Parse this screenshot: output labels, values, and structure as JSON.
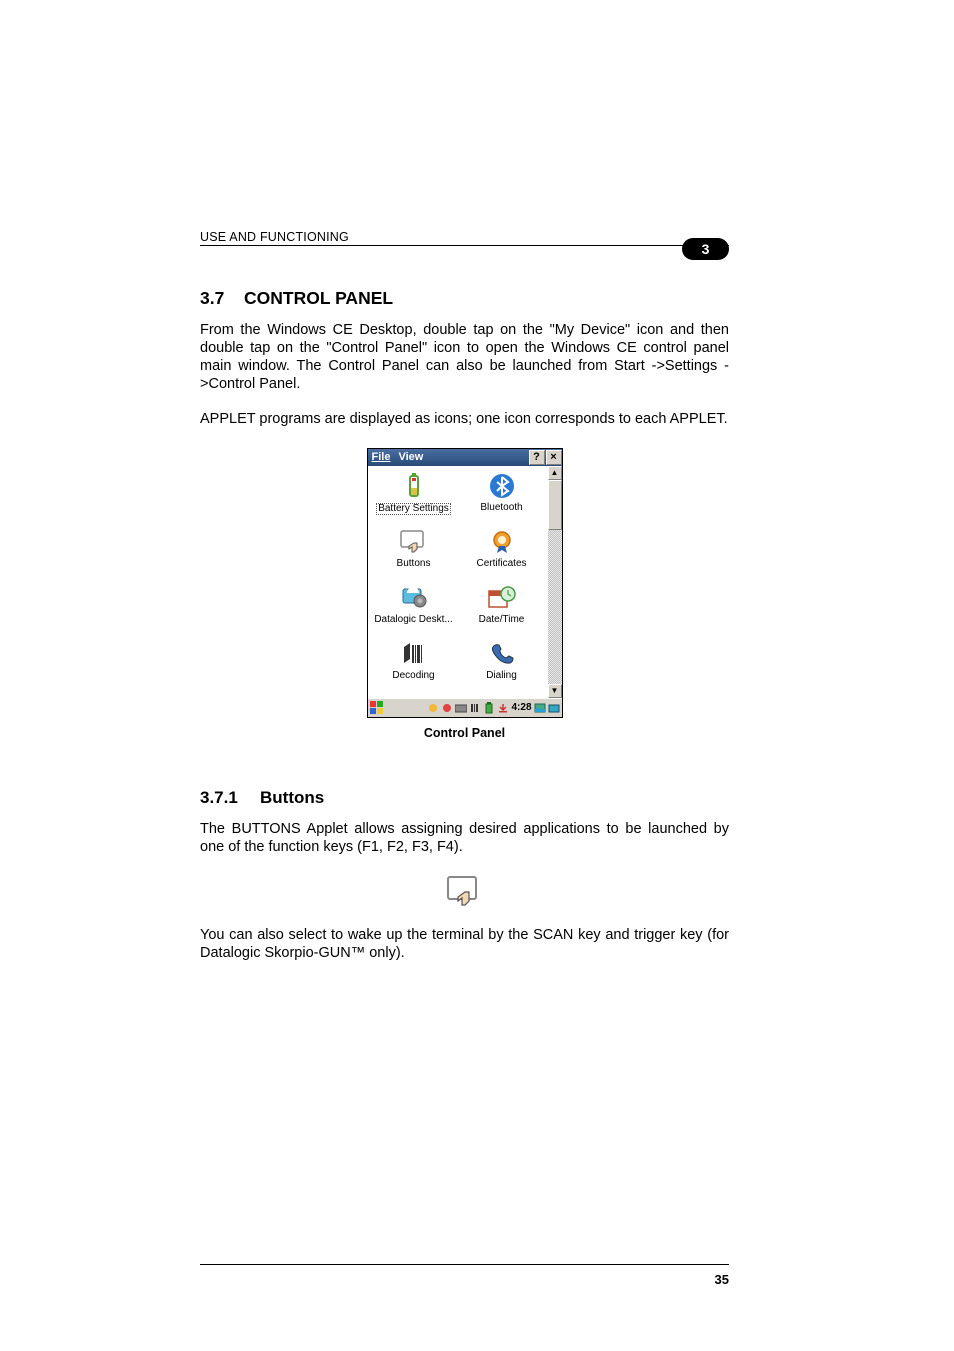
{
  "header": {
    "chapter_title": "USE AND FUNCTIONING",
    "chapter_number": "3"
  },
  "section1": {
    "number": "3.7",
    "title": "CONTROL PANEL",
    "para1": "From the Windows CE Desktop, double tap on the \"My Device\" icon and then double tap on the \"Control Panel\" icon to open the Windows CE control panel main window. The Control Panel can also be launched from Start ->Settings ->Control Panel.",
    "para2": "APPLET programs are displayed as icons; one icon corresponds to each APPLET."
  },
  "ce_window": {
    "menu": {
      "file": "File",
      "view": "View"
    },
    "titlebar": {
      "help": "?",
      "close": "×"
    },
    "applets": [
      {
        "label": "Battery Settings",
        "icon": "battery-icon",
        "selected": true
      },
      {
        "label": "Bluetooth",
        "icon": "bluetooth-icon"
      },
      {
        "label": "Buttons",
        "icon": "buttons-icon"
      },
      {
        "label": "Certificates",
        "icon": "certificates-icon"
      },
      {
        "label": "Datalogic Deskt...",
        "icon": "desktop-icon"
      },
      {
        "label": "Date/Time",
        "icon": "datetime-icon"
      },
      {
        "label": "Decoding",
        "icon": "decoding-icon"
      },
      {
        "label": "Dialing",
        "icon": "dialing-icon"
      }
    ],
    "taskbar": {
      "clock": "4:28"
    }
  },
  "figure_caption": "Control Panel",
  "section2": {
    "number": "3.7.1",
    "title": "Buttons",
    "para1": "The BUTTONS Applet allows assigning desired applications to be launched by one of the function keys (F1, F2, F3, F4).",
    "para2": "You can also select to wake up the terminal by the SCAN key and trigger key (for Datalogic Skorpio-GUN™ only)."
  },
  "page_number": "35"
}
